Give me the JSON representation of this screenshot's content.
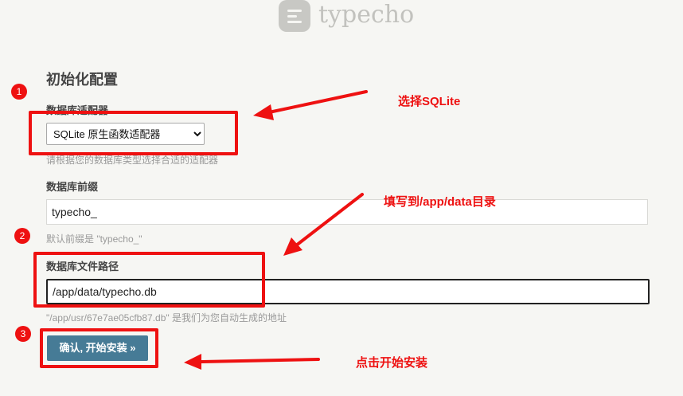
{
  "logo": {
    "text": "typecho"
  },
  "page_title": "初始化配置",
  "adapter": {
    "label": "数据库适配器",
    "selected": "SQLite 原生函数适配器",
    "hint": "请根据您的数据库类型选择合适的适配器"
  },
  "prefix": {
    "label": "数据库前缀",
    "value": "typecho_",
    "hint": "默认前缀是 \"typecho_\""
  },
  "db_file": {
    "label": "数据库文件路径",
    "value": "/app/data/typecho.db",
    "hint": "\"/app/usr/67e7ae05cfb87.db\" 是我们为您自动生成的地址"
  },
  "submit_label": "确认, 开始安装 »",
  "annotations": {
    "step1": "1",
    "step2": "2",
    "step3": "3",
    "note1": "选择SQLite",
    "note2": "填写到/app/data目录",
    "note3": "点击开始安装",
    "color": "#ee1111"
  }
}
